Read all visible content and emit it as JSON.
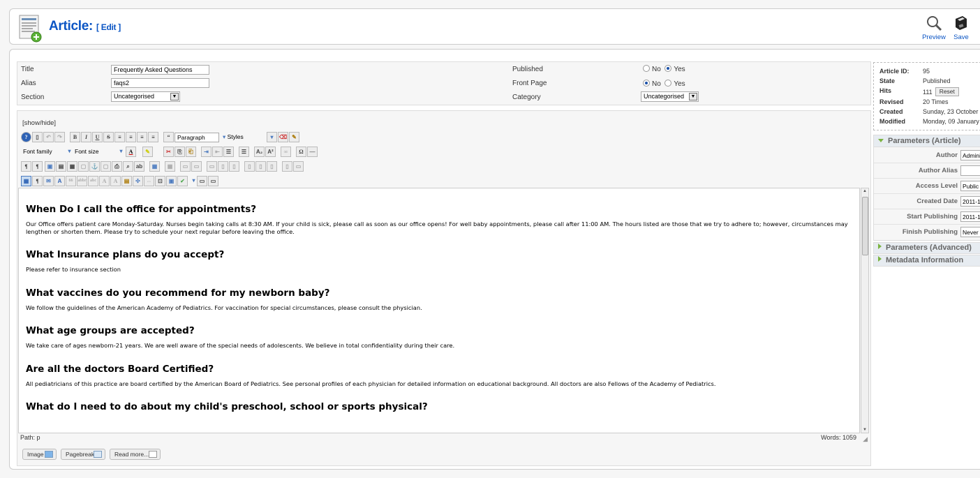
{
  "header": {
    "title": "Article:",
    "subtitle": "[ Edit ]",
    "preview_label": "Preview",
    "save_label": "Save"
  },
  "form": {
    "title_label": "Title",
    "title_value": "Frequently Asked Questions",
    "alias_label": "Alias",
    "alias_value": "faqs2",
    "section_label": "Section",
    "section_value": "Uncategorised",
    "published_label": "Published",
    "frontpage_label": "Front Page",
    "category_label": "Category",
    "category_value": "Uncategorised",
    "no_label": "No",
    "yes_label": "Yes",
    "published_value": "Yes",
    "frontpage_value": "No"
  },
  "editor": {
    "show_hide": "[show/hide]",
    "font_family": "Font family",
    "font_size": "Font size",
    "paragraph": "Paragraph",
    "styles": "Styles",
    "path": "Path:  p",
    "words": "Words: 1059",
    "sections": [
      {
        "heading": "When Do I call the office for appointments?",
        "body": "Our Office offers patient care Monday-Saturday. Nurses begin taking calls at 8:30 AM. If your child is sick, please call as soon as our office opens! For well baby appointments, please call after 11:00 AM. The hours listed are those that we try to adhere to; however, circumstances may lengthen or shorten them. Please try to schedule your next regular before leaving the office."
      },
      {
        "heading": "What Insurance plans do you accept?",
        "body": "Please refer to insurance section"
      },
      {
        "heading": "What vaccines do you recommend for my newborn baby?",
        "body": "We follow the guidelines of the American Academy of Pediatrics. For vaccination for special circumstances, please consult the physician."
      },
      {
        "heading": "What age groups are accepted?",
        "body": "We take care of ages newborn-21 years. We are well aware of the special needs of adolescents. We believe in total confidentiality during their care."
      },
      {
        "heading": "Are all the doctors Board Certified?",
        "body": "All pediatricians of this practice are board certified by the American Board of Pediatrics. See personal profiles of each physician for detailed information on educational background. All doctors are also Fellows of the Academy of Pediatrics."
      },
      {
        "heading": "What do I need to do about my child's preschool, school or sports physical?",
        "body": ""
      }
    ]
  },
  "buttons": {
    "image": "Image",
    "pagebreak": "Pagebreak",
    "readmore": "Read more..."
  },
  "info": {
    "id_label": "Article ID:",
    "id_value": "95",
    "state_label": "State",
    "state_value": "Published",
    "hits_label": "Hits",
    "hits_value": "111",
    "reset_label": "Reset",
    "revised_label": "Revised",
    "revised_value": "20 Times",
    "created_label": "Created",
    "created_value": "Sunday, 23 October",
    "modified_label": "Modified",
    "modified_value": "Monday, 09 January"
  },
  "params": {
    "article_header": "Parameters (Article)",
    "author_label": "Author",
    "author_value": "Admini",
    "alias_label": "Author Alias",
    "alias_value": "",
    "access_label": "Access Level",
    "access_value": "Public",
    "created_label": "Created Date",
    "created_value": "2011-1",
    "start_label": "Start Publishing",
    "start_value": "2011-1",
    "finish_label": "Finish Publishing",
    "finish_value": "Never",
    "advanced_header": "Parameters (Advanced)",
    "metadata_header": "Metadata Information"
  },
  "colors": {
    "title_blue": "#0b55c4",
    "panel_green_arrow": "#7cb342"
  }
}
